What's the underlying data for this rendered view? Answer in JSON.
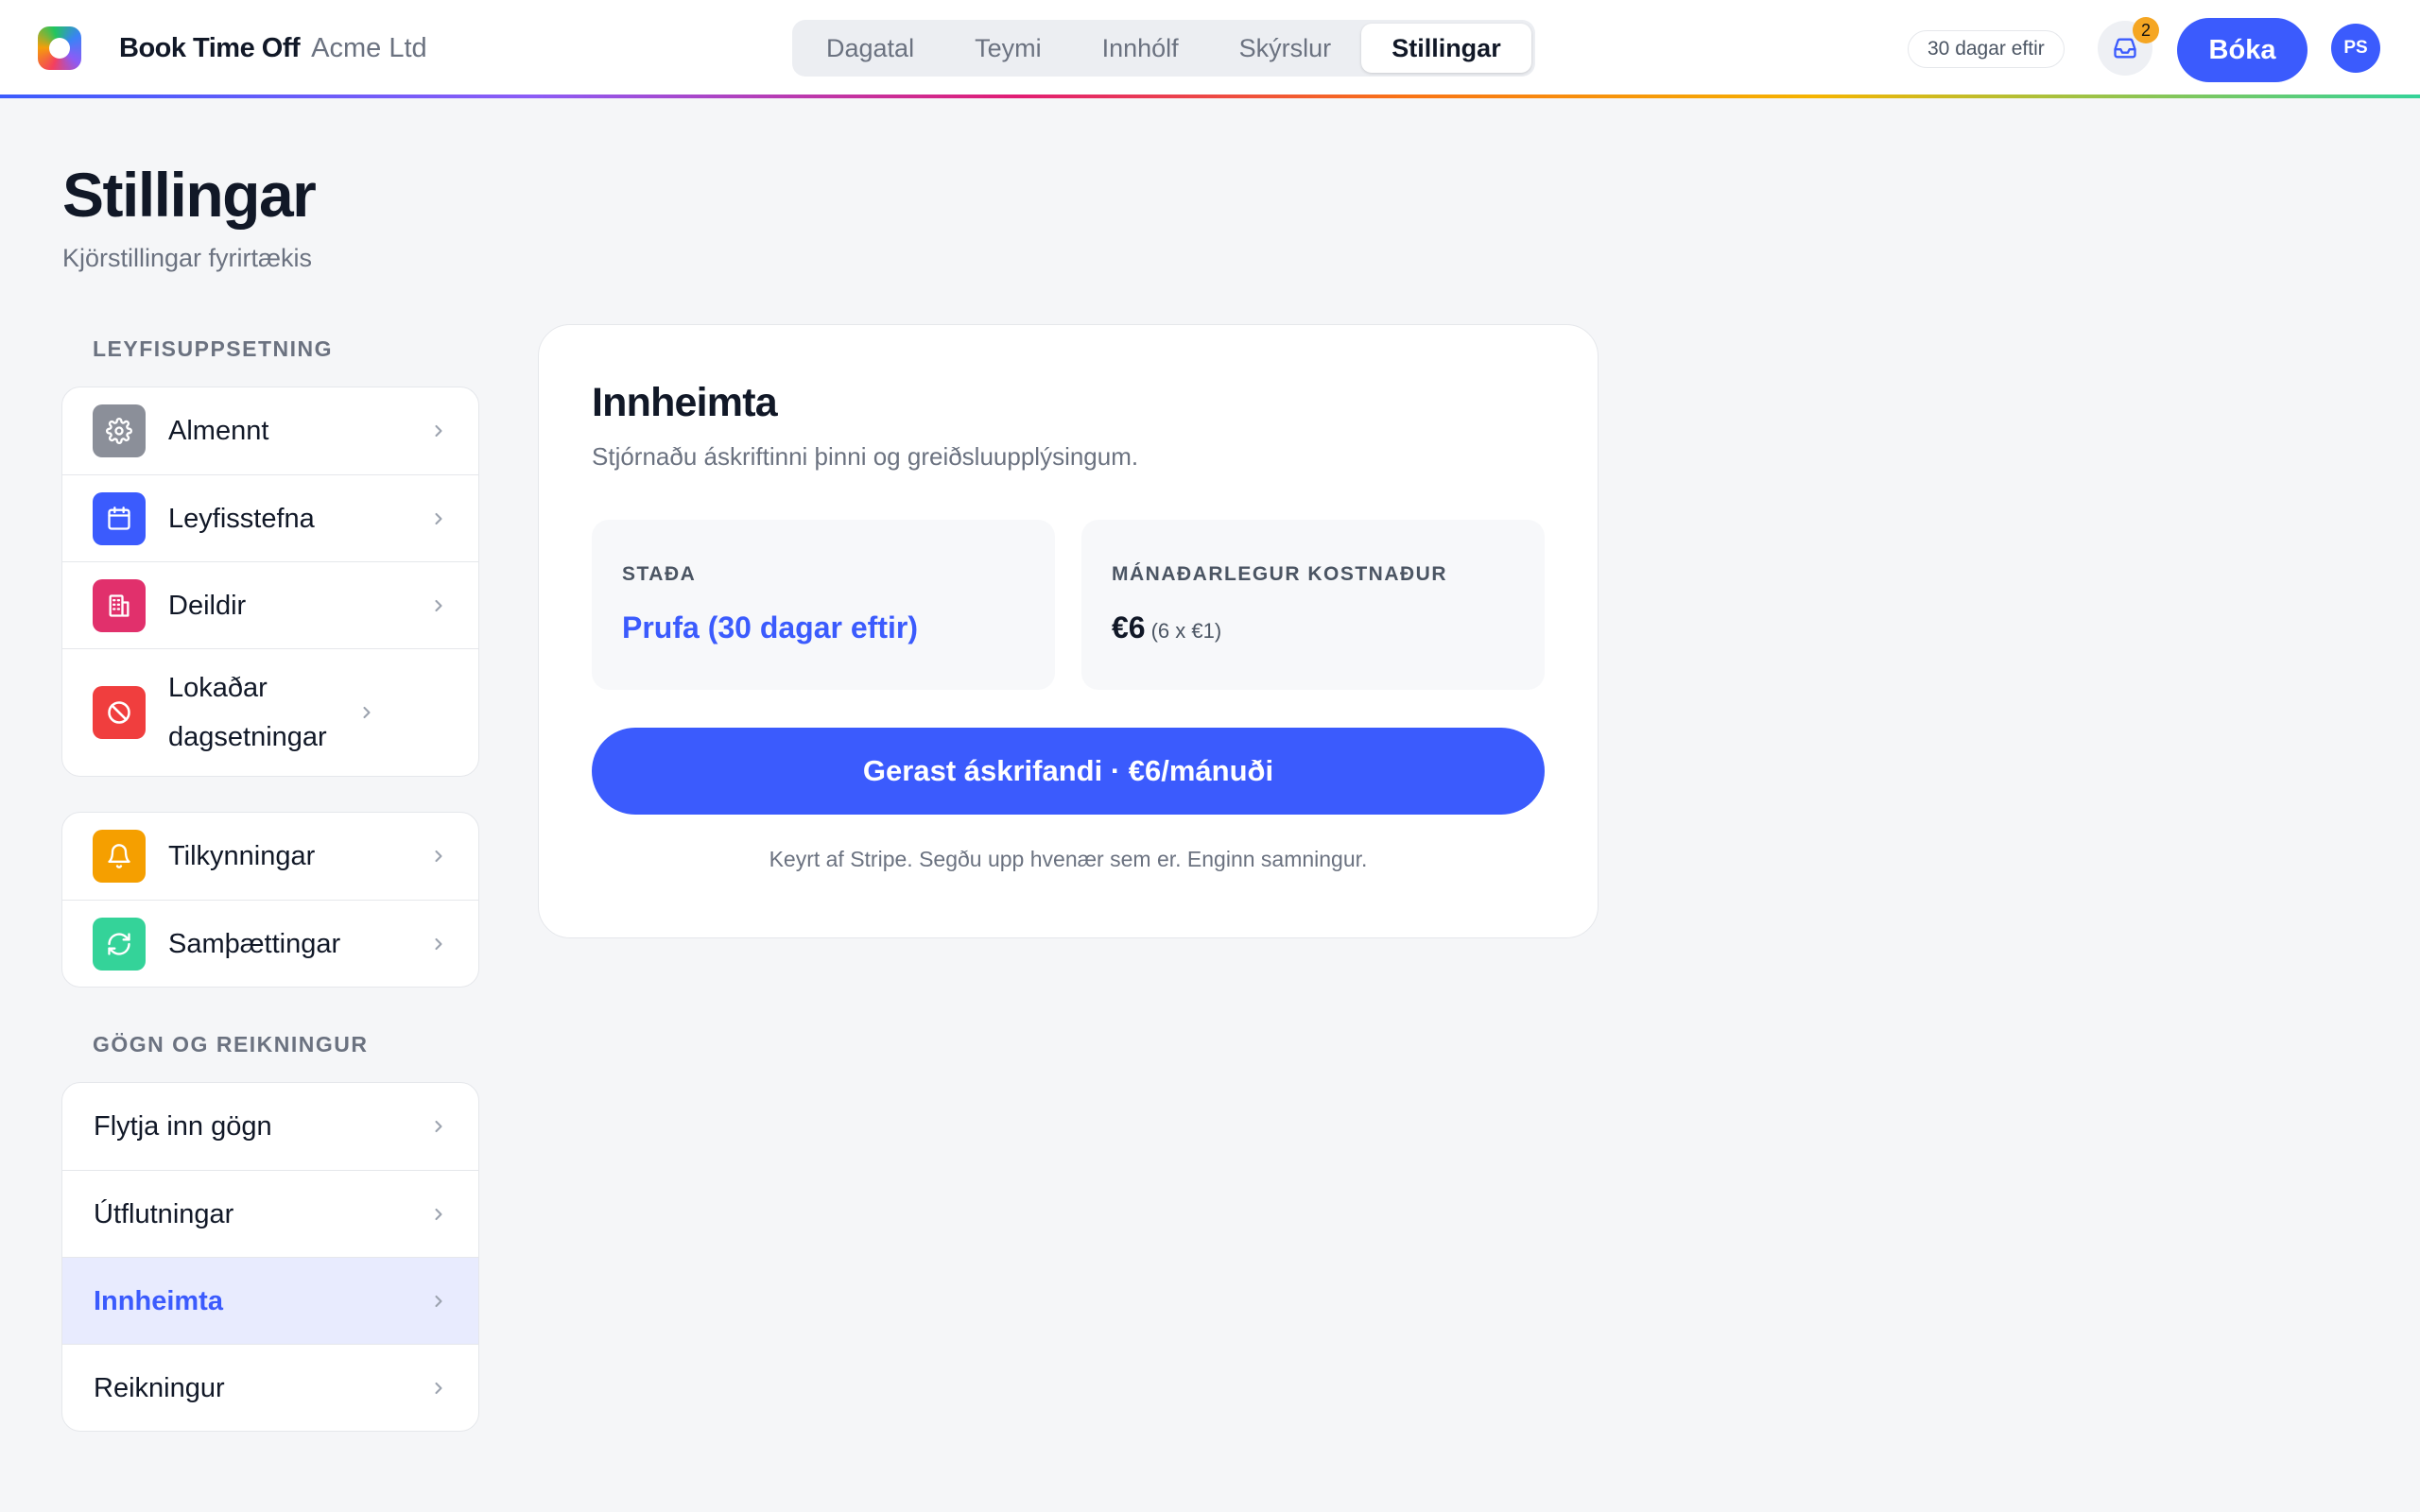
{
  "app": {
    "name": "Book Time Off",
    "company": "Acme Ltd"
  },
  "nav": {
    "tabs": [
      {
        "label": "Dagatal"
      },
      {
        "label": "Teymi"
      },
      {
        "label": "Innhólf"
      },
      {
        "label": "Skýrslur"
      },
      {
        "label": "Stillingar",
        "active": true
      }
    ]
  },
  "header": {
    "trial": "30 dagar eftir",
    "inbox_count": "2",
    "book_label": "Bóka",
    "avatar_initials": "PS"
  },
  "page": {
    "title": "Stillingar",
    "subtitle": "Kjörstillingar fyrirtækis"
  },
  "sidebar": {
    "section1_label": "LEYFISUPPSETNING",
    "group1": [
      {
        "label": "Almennt",
        "icon": "gear-icon",
        "color": "#8b8f99"
      },
      {
        "label": "Leyfisstefna",
        "icon": "calendar-icon",
        "color": "#3b5bfd"
      },
      {
        "label": "Deildir",
        "icon": "building-icon",
        "color": "#e1306c"
      },
      {
        "label": "Lokaðar dagsetningar",
        "icon": "block-icon",
        "color": "#f03e3e"
      }
    ],
    "group2": [
      {
        "label": "Tilkynningar",
        "icon": "bell-icon",
        "color": "#f59f00"
      },
      {
        "label": "Samþættingar",
        "icon": "sync-icon",
        "color": "#34d399"
      }
    ],
    "section2_label": "GÖGN OG REIKNINGUR",
    "group3": [
      {
        "label": "Flytja inn gögn"
      },
      {
        "label": "Útflutningar"
      },
      {
        "label": "Innheimta",
        "active": true
      },
      {
        "label": "Reikningur"
      }
    ]
  },
  "billing": {
    "title": "Innheimta",
    "subtitle": "Stjórnaðu áskriftinni þinni og greiðsluupplýsingum.",
    "status_label": "STAÐA",
    "status_value": "Prufa (30 dagar eftir)",
    "cost_label": "MÁNAÐARLEGUR KOSTNAÐUR",
    "cost_value": "€6",
    "cost_note": "(6 x €1)",
    "subscribe_label": "Gerast áskrifandi · €6/mánuði",
    "footnote": "Keyrt af Stripe. Segðu upp hvenær sem er. Enginn samningur."
  },
  "colors": {
    "accent": "#3b5bfd",
    "accent_light": "#e8ebfe"
  }
}
